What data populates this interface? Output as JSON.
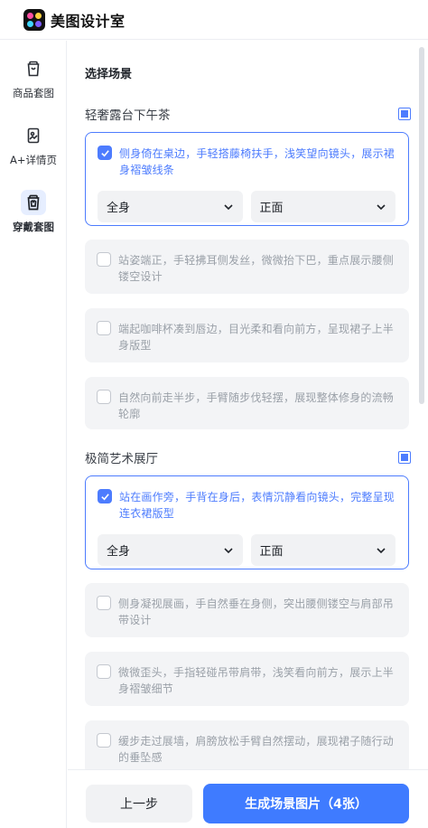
{
  "app": {
    "title": "美图设计室"
  },
  "sidebar": {
    "items": [
      {
        "label": "商品套图",
        "icon": "product-bag-icon",
        "active": false
      },
      {
        "label": "A+详情页",
        "icon": "detail-page-icon",
        "active": false
      },
      {
        "label": "穿戴套图",
        "icon": "wearable-bag-icon",
        "active": true
      }
    ]
  },
  "main": {
    "section_title": "选择场景",
    "groups": [
      {
        "name": "轻奢露台下午茶",
        "cards": [
          {
            "text": "侧身倚在桌边，手轻搭藤椅扶手，浅笑望向镜头，展示裙身褶皱线条",
            "checked": true,
            "selects": [
              "全身",
              "正面"
            ]
          },
          {
            "text": "站姿端正，手轻拂耳侧发丝，微微抬下巴，重点展示腰侧镂空设计",
            "checked": false
          },
          {
            "text": "端起咖啡杯凑到唇边，目光柔和看向前方，呈现裙子上半身版型",
            "checked": false
          },
          {
            "text": "自然向前走半步，手臂随步伐轻摆，展现整体修身的流畅轮廓",
            "checked": false
          }
        ]
      },
      {
        "name": "极简艺术展厅",
        "cards": [
          {
            "text": "站在画作旁，手背在身后，表情沉静看向镜头，完整呈现连衣裙版型",
            "checked": true,
            "selects": [
              "全身",
              "正面"
            ]
          },
          {
            "text": "侧身凝视展画，手自然垂在身侧，突出腰侧镂空与肩部吊带设计",
            "checked": false
          },
          {
            "text": "微微歪头，手指轻碰吊带肩带，浅笑看向前方，展示上半身褶皱细节",
            "checked": false
          },
          {
            "text": "缓步走过展墙，肩膀放松手臂自然摆动，展现裙子随行动的垂坠感",
            "checked": false
          }
        ]
      }
    ]
  },
  "footer": {
    "prev_label": "上一步",
    "generate_label": "生成场景图片（4张）"
  },
  "colors": {
    "accent": "#4d7cfe",
    "primary_button": "#3f7bff"
  }
}
